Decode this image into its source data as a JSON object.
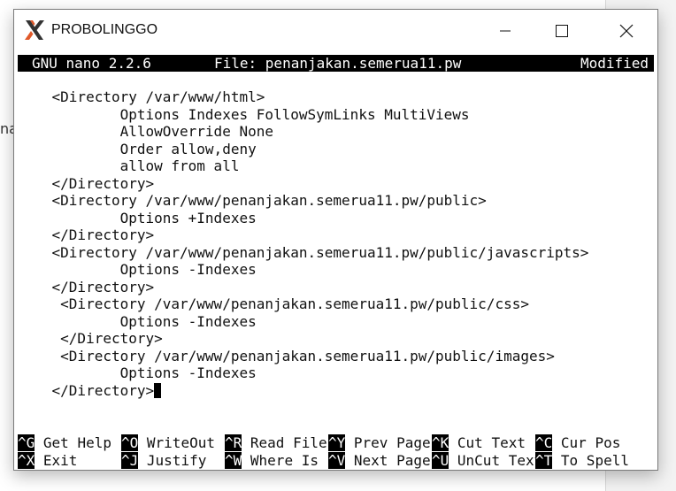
{
  "background": {
    "left_fragment": "na"
  },
  "window": {
    "title": "PROBOLINGGO",
    "icon": "x-logo-icon",
    "controls": [
      "minimize-icon",
      "maximize-icon",
      "close-icon"
    ]
  },
  "nano": {
    "version": "GNU nano 2.2.6",
    "file": "File: penanjakan.semerua11.pw",
    "status": "Modified"
  },
  "code_lines": [
    "    <Directory /var/www/html>",
    "            Options Indexes FollowSymLinks MultiViews",
    "            AllowOverride None",
    "            Order allow,deny",
    "            allow from all",
    "    </Directory>",
    "    <Directory /var/www/penanjakan.semerua11.pw/public>",
    "            Options +Indexes",
    "    </Directory>",
    "    <Directory /var/www/penanjakan.semerua11.pw/public/javascripts>",
    "            Options -Indexes",
    "    </Directory>",
    "     <Directory /var/www/penanjakan.semerua11.pw/public/css>",
    "            Options -Indexes",
    "     </Directory>",
    "     <Directory /var/www/penanjakan.semerua11.pw/public/images>",
    "            Options -Indexes",
    "    </Directory>"
  ],
  "shortcuts": {
    "row1": [
      {
        "key": "^G",
        "label": "Get Help"
      },
      {
        "key": "^O",
        "label": "WriteOut"
      },
      {
        "key": "^R",
        "label": "Read File"
      },
      {
        "key": "^Y",
        "label": "Prev Page"
      },
      {
        "key": "^K",
        "label": "Cut Text"
      },
      {
        "key": "^C",
        "label": "Cur Pos"
      }
    ],
    "row2": [
      {
        "key": "^X",
        "label": "Exit"
      },
      {
        "key": "^J",
        "label": "Justify"
      },
      {
        "key": "^W",
        "label": "Where Is"
      },
      {
        "key": "^V",
        "label": "Next Page"
      },
      {
        "key": "^U",
        "label": "UnCut Text"
      },
      {
        "key": "^T",
        "label": "To Spell"
      }
    ]
  }
}
